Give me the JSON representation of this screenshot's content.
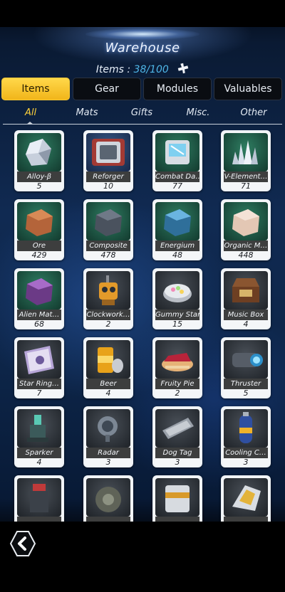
{
  "header": {
    "title": "Warehouse",
    "items_label": "Items :",
    "items_count": "38/100",
    "expand_icon": "plus-expand-icon"
  },
  "tabs": [
    {
      "label": "Items",
      "active": true
    },
    {
      "label": "Gear",
      "active": false
    },
    {
      "label": "Modules",
      "active": false
    },
    {
      "label": "Valuables",
      "active": false
    }
  ],
  "subtabs": [
    {
      "label": "All",
      "active": true
    },
    {
      "label": "Mats",
      "active": false
    },
    {
      "label": "Gifts",
      "active": false
    },
    {
      "label": "Misc.",
      "active": false
    },
    {
      "label": "Other",
      "active": false
    }
  ],
  "items": [
    {
      "name": "Alloy-β",
      "qty": "5",
      "icon": "alloy-crystal-icon",
      "bg": "green"
    },
    {
      "name": "Reforger",
      "qty": "10",
      "icon": "reforger-device-icon",
      "bg": "blue"
    },
    {
      "name": "Combat Da…",
      "qty": "77",
      "icon": "combat-data-chip-icon",
      "bg": "green"
    },
    {
      "name": "V-Element…",
      "qty": "71",
      "icon": "v-element-crystal-icon",
      "bg": "green"
    },
    {
      "name": "Ore",
      "qty": "429",
      "icon": "ore-cube-icon",
      "bg": "green"
    },
    {
      "name": "Composite",
      "qty": "478",
      "icon": "composite-cube-icon",
      "bg": "green"
    },
    {
      "name": "Energium",
      "qty": "48",
      "icon": "energium-cube-icon",
      "bg": "green"
    },
    {
      "name": "Organic M…",
      "qty": "448",
      "icon": "organic-matter-cube-icon",
      "bg": "green"
    },
    {
      "name": "Alien Mat…",
      "qty": "68",
      "icon": "alien-material-cube-icon",
      "bg": "green"
    },
    {
      "name": "Clockwork…",
      "qty": "2",
      "icon": "clockwork-robot-icon",
      "bg": "gray"
    },
    {
      "name": "Gummy Star",
      "qty": "15",
      "icon": "gummy-star-tin-icon",
      "bg": "gray"
    },
    {
      "name": "Music Box",
      "qty": "4",
      "icon": "music-box-icon",
      "bg": "gray"
    },
    {
      "name": "Star Ring…",
      "qty": "7",
      "icon": "star-ring-record-icon",
      "bg": "gray"
    },
    {
      "name": "Beer",
      "qty": "4",
      "icon": "beer-can-icon",
      "bg": "gray"
    },
    {
      "name": "Fruity Pie",
      "qty": "2",
      "icon": "fruity-pie-icon",
      "bg": "gray"
    },
    {
      "name": "Thruster",
      "qty": "5",
      "icon": "thruster-icon",
      "bg": "gray"
    },
    {
      "name": "Sparker",
      "qty": "4",
      "icon": "sparker-icon",
      "bg": "gray"
    },
    {
      "name": "Radar",
      "qty": "3",
      "icon": "radar-dish-icon",
      "bg": "gray"
    },
    {
      "name": "Dog Tag",
      "qty": "3",
      "icon": "dog-tag-icon",
      "bg": "gray"
    },
    {
      "name": "Cooling C…",
      "qty": "3",
      "icon": "cooling-canister-icon",
      "bg": "gray"
    },
    {
      "name": "",
      "qty": "",
      "icon": "turret-part-icon",
      "bg": "gray"
    },
    {
      "name": "",
      "qty": "",
      "icon": "gear-part-icon",
      "bg": "gray"
    },
    {
      "name": "",
      "qty": "",
      "icon": "battery-part-icon",
      "bg": "gray"
    },
    {
      "name": "",
      "qty": "",
      "icon": "mech-part-icon",
      "bg": "gray"
    }
  ],
  "footer": {
    "back_icon": "back-chevron-icon"
  }
}
